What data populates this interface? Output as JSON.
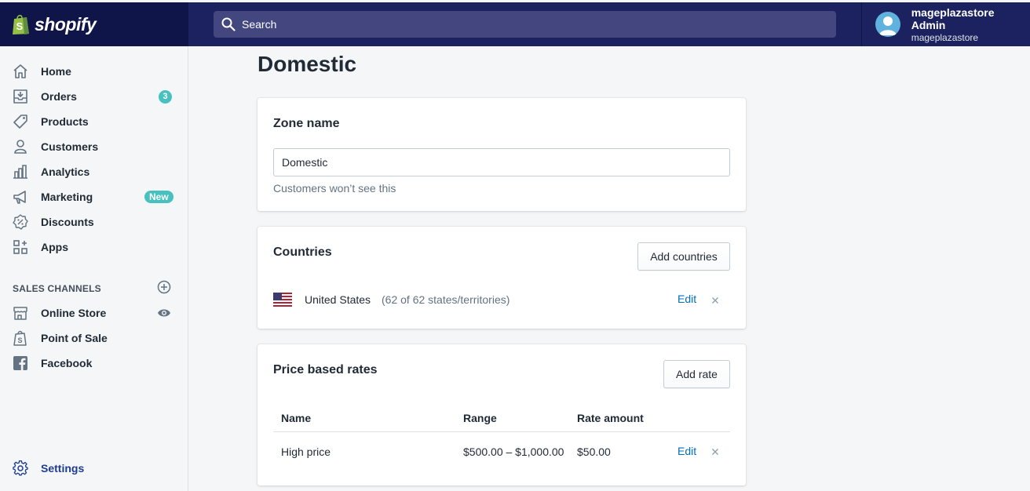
{
  "brand": {
    "name": "shopify",
    "colors": {
      "top_bar": "#1c2260",
      "logo_bg": "#0f1548",
      "bag_green": "#95bf47",
      "accent_teal": "#47c1bf",
      "link_blue": "#006fbb"
    }
  },
  "search": {
    "placeholder": "Search"
  },
  "user": {
    "name": "mageplazastore Admin",
    "store": "mageplazastore"
  },
  "sidebar": {
    "items": [
      {
        "label": "Home",
        "icon": "home-icon"
      },
      {
        "label": "Orders",
        "icon": "orders-icon",
        "badge": "3"
      },
      {
        "label": "Products",
        "icon": "tag-icon"
      },
      {
        "label": "Customers",
        "icon": "person-icon"
      },
      {
        "label": "Analytics",
        "icon": "bar-chart-icon"
      },
      {
        "label": "Marketing",
        "icon": "megaphone-icon",
        "badge": "New"
      },
      {
        "label": "Discounts",
        "icon": "discount-icon"
      },
      {
        "label": "Apps",
        "icon": "apps-icon"
      }
    ],
    "sales_channels_title": "SALES CHANNELS",
    "channels": [
      {
        "label": "Online Store",
        "icon": "store-icon"
      },
      {
        "label": "Point of Sale",
        "icon": "pos-bag-icon"
      },
      {
        "label": "Facebook",
        "icon": "facebook-icon"
      }
    ],
    "settings_label": "Settings"
  },
  "page": {
    "title": "Domestic"
  },
  "zone_card": {
    "heading": "Zone name",
    "value": "Domestic",
    "help": "Customers won’t see this"
  },
  "countries_card": {
    "heading": "Countries",
    "add_button": "Add countries",
    "rows": [
      {
        "name": "United States",
        "detail": "(62 of 62 states/territories)",
        "edit": "Edit"
      }
    ]
  },
  "rates_card": {
    "heading": "Price based rates",
    "add_button": "Add rate",
    "columns": [
      "Name",
      "Range",
      "Rate amount"
    ],
    "rows": [
      {
        "name": "High price",
        "range": "$500.00 – $1,000.00",
        "amount": "$50.00",
        "edit": "Edit"
      }
    ]
  }
}
